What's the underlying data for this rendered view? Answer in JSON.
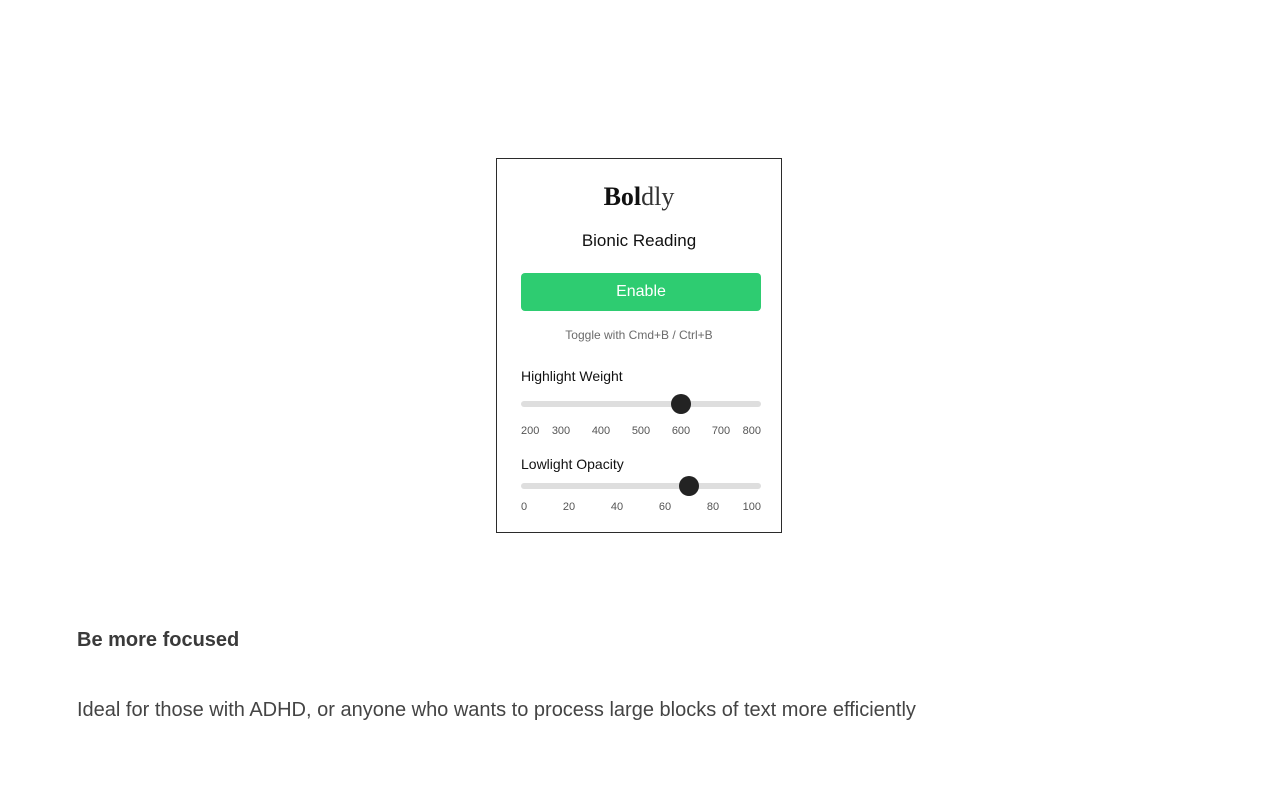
{
  "popup": {
    "logo_bold": "Bol",
    "logo_light": "dly",
    "subtitle": "Bionic Reading",
    "enable_label": "Enable",
    "hint": "Toggle with Cmd+B / Ctrl+B",
    "highlight_weight": {
      "label": "Highlight Weight",
      "min": 200,
      "max": 800,
      "value": 600,
      "ticks": [
        "200",
        "300",
        "400",
        "500",
        "600",
        "700",
        "800"
      ]
    },
    "lowlight_opacity": {
      "label": "Lowlight Opacity",
      "min": 0,
      "max": 100,
      "value": 70,
      "ticks": [
        "0",
        "20",
        "40",
        "60",
        "80",
        "100"
      ]
    },
    "colors": {
      "enable_bg": "#2ecc71",
      "thumb": "#232323",
      "track": "#dedede"
    }
  },
  "feature": {
    "title": "Be more focused",
    "description": "Ideal for those with ADHD, or anyone who wants to process large blocks of text more efficiently"
  }
}
